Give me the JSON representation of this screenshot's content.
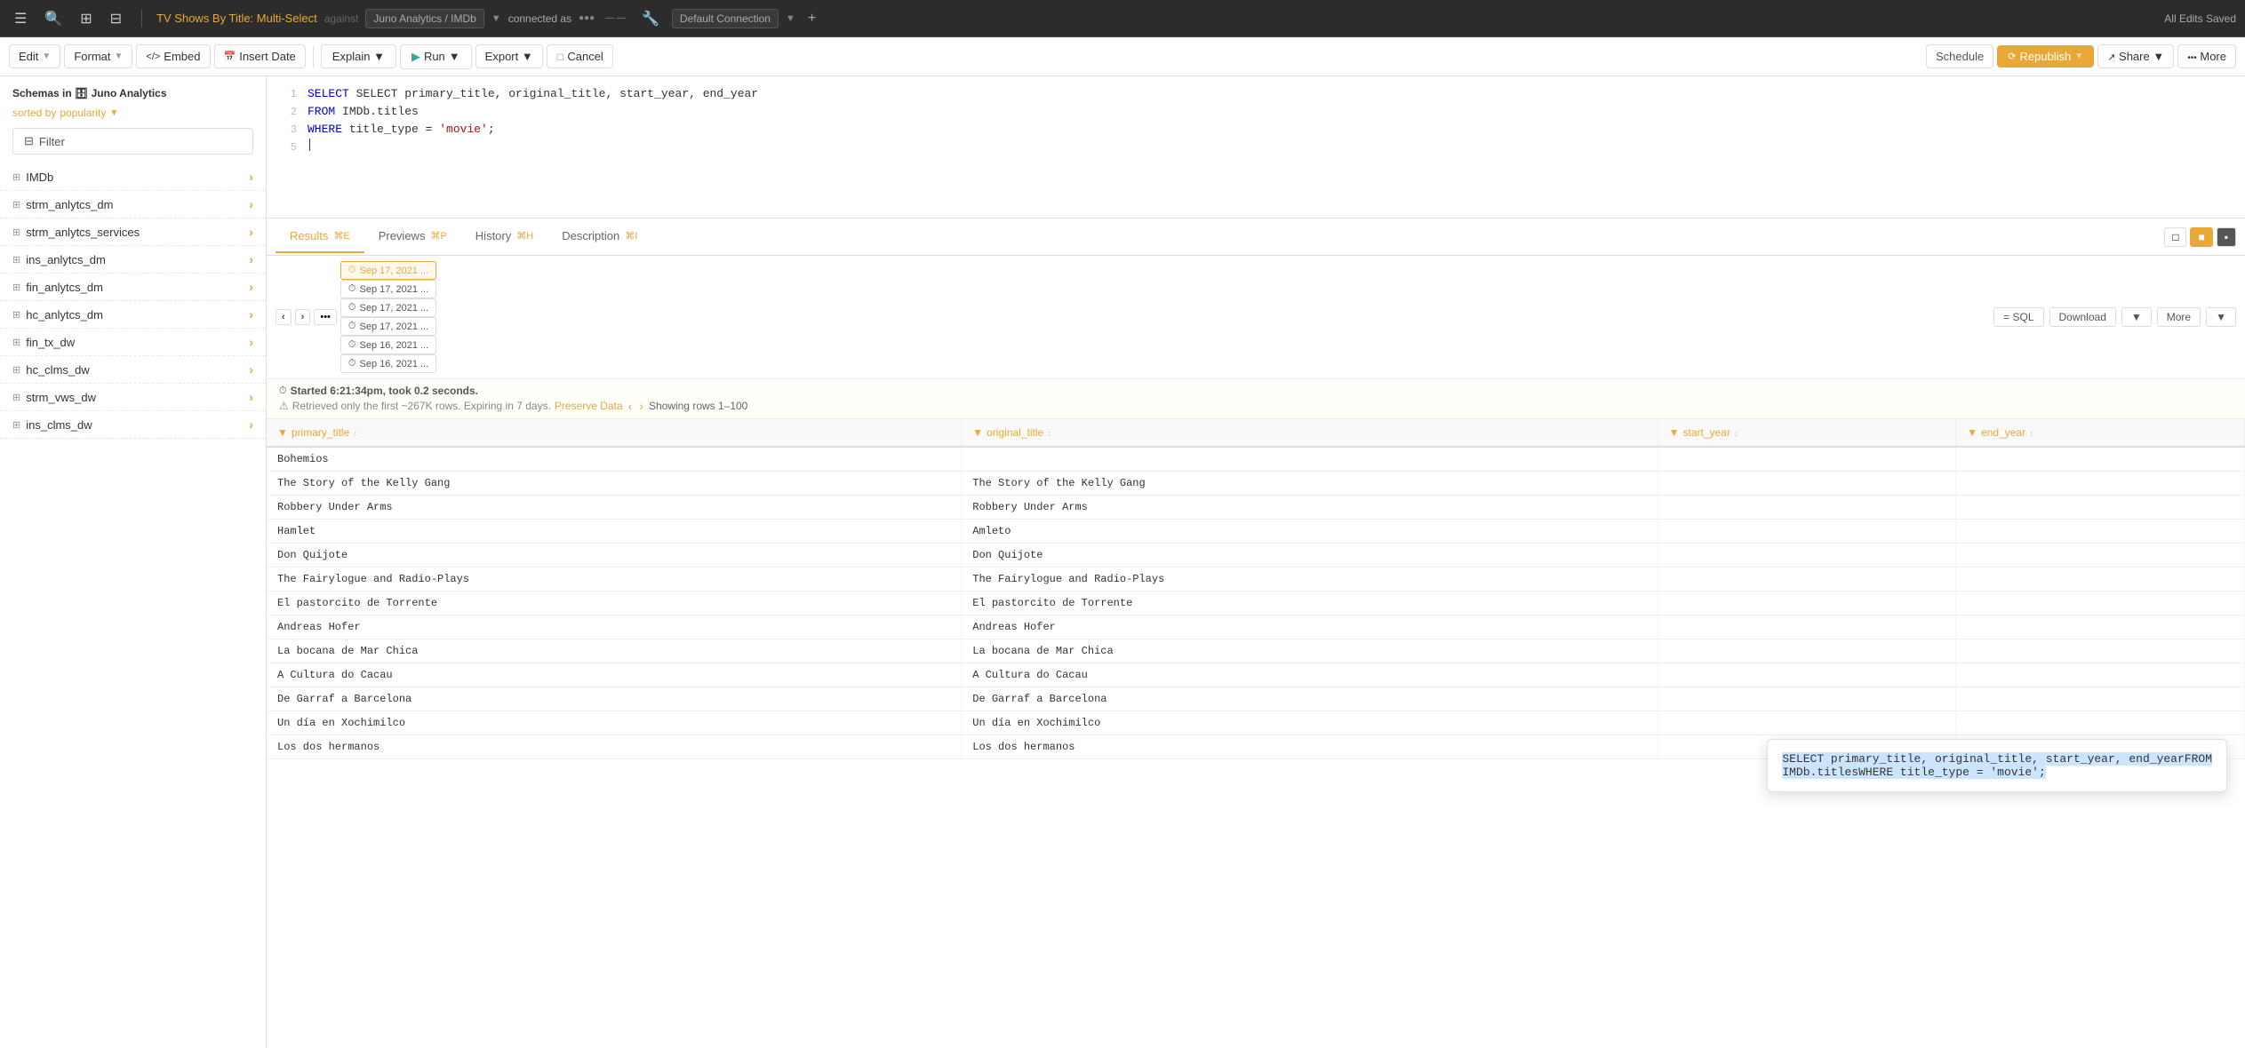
{
  "topnav": {
    "title": "TV Shows By Title: Multi-Select",
    "against": "against",
    "db": "Juno Analytics / IMDb",
    "connected_as": "connected as",
    "connection": "Default Connection",
    "saved": "All Edits Saved"
  },
  "toolbar": {
    "edit": "Edit",
    "format": "Format",
    "embed": "Embed",
    "insert_date": "Insert Date",
    "explain": "Explain",
    "run": "Run",
    "export": "Export",
    "cancel": "Cancel",
    "schedule": "Schedule",
    "republish": "Republish",
    "share": "Share",
    "more": "More"
  },
  "sidebar": {
    "header": "Schemas in",
    "org": "Juno Analytics",
    "sorted": "sorted by",
    "sort_by": "popularity",
    "filter": "Filter",
    "schemas": [
      {
        "name": "IMDb"
      },
      {
        "name": "strm_anlytcs_dm"
      },
      {
        "name": "strm_anlytcs_services"
      },
      {
        "name": "ins_anlytcs_dm"
      },
      {
        "name": "fin_anlytcs_dm"
      },
      {
        "name": "hc_anlytcs_dm"
      },
      {
        "name": "fin_tx_dw"
      },
      {
        "name": "hc_clms_dw"
      },
      {
        "name": "strm_vws_dw"
      },
      {
        "name": "ins_clms_dw"
      }
    ]
  },
  "sql": {
    "line1": "SELECT primary_title, original_title, start_year, end_year",
    "line2": "FROM IMDb.titles",
    "line3": "WHERE title_type = 'movie';"
  },
  "tabs": {
    "results": "Results",
    "results_shortcut": "⌘E",
    "previews": "Previews",
    "previews_shortcut": "⌘P",
    "history": "History",
    "history_shortcut": "⌘H",
    "description": "Description",
    "description_shortcut": "⌘I"
  },
  "results_toolbar": {
    "sql_btn": "= SQL",
    "download_btn": "Download",
    "more_btn": "More",
    "history_tabs": [
      {
        "label": "Sep 17, 2021 ...",
        "active": true
      },
      {
        "label": "Sep 17, 2021 ..."
      },
      {
        "label": "Sep 17, 2021 ..."
      },
      {
        "label": "Sep 17, 2021 ..."
      },
      {
        "label": "Sep 16, 2021 ..."
      },
      {
        "label": "Sep 16, 2021 ..."
      }
    ]
  },
  "status": {
    "time": "Started 6:21:34pm, took 0.2 seconds.",
    "warning": "Retrieved only the first ~267K rows. Expiring in 7 days.",
    "preserve": "Preserve Data",
    "rows": "Showing rows 1–100"
  },
  "columns": [
    "primary_title",
    "original_title",
    "start_year",
    "end_year"
  ],
  "rows": [
    [
      "Bohemios",
      "",
      "",
      ""
    ],
    [
      "The Story of the Kelly Gang",
      "The Story of the Kelly Gang",
      "",
      ""
    ],
    [
      "Robbery Under Arms",
      "Robbery Under Arms",
      "",
      ""
    ],
    [
      "Hamlet",
      "Amleto",
      "",
      ""
    ],
    [
      "Don Quijote",
      "Don Quijote",
      "",
      ""
    ],
    [
      "The Fairylogue and Radio-Plays",
      "The Fairylogue and Radio-Plays",
      "",
      ""
    ],
    [
      "El pastorcito de Torrente",
      "El pastorcito de Torrente",
      "",
      ""
    ],
    [
      "Andreas Hofer",
      "Andreas Hofer",
      "",
      ""
    ],
    [
      "La bocana de Mar Chica",
      "La bocana de Mar Chica",
      "",
      ""
    ],
    [
      "A Cultura do Cacau",
      "A Cultura do Cacau",
      "",
      ""
    ],
    [
      "De Garraf a Barcelona",
      "De Garraf a Barcelona",
      "",
      ""
    ],
    [
      "Un día en Xochimilco",
      "Un día en Xochimilco",
      "",
      ""
    ],
    [
      "Los dos hermanos",
      "Los dos hermanos",
      "",
      ""
    ]
  ],
  "sql_tooltip": {
    "line1_selected": "SELECT primary_title, original_title, start_year, end_yearFROM",
    "line2_selected": "IMDb.titlesWHERE title_type = 'movie';"
  }
}
